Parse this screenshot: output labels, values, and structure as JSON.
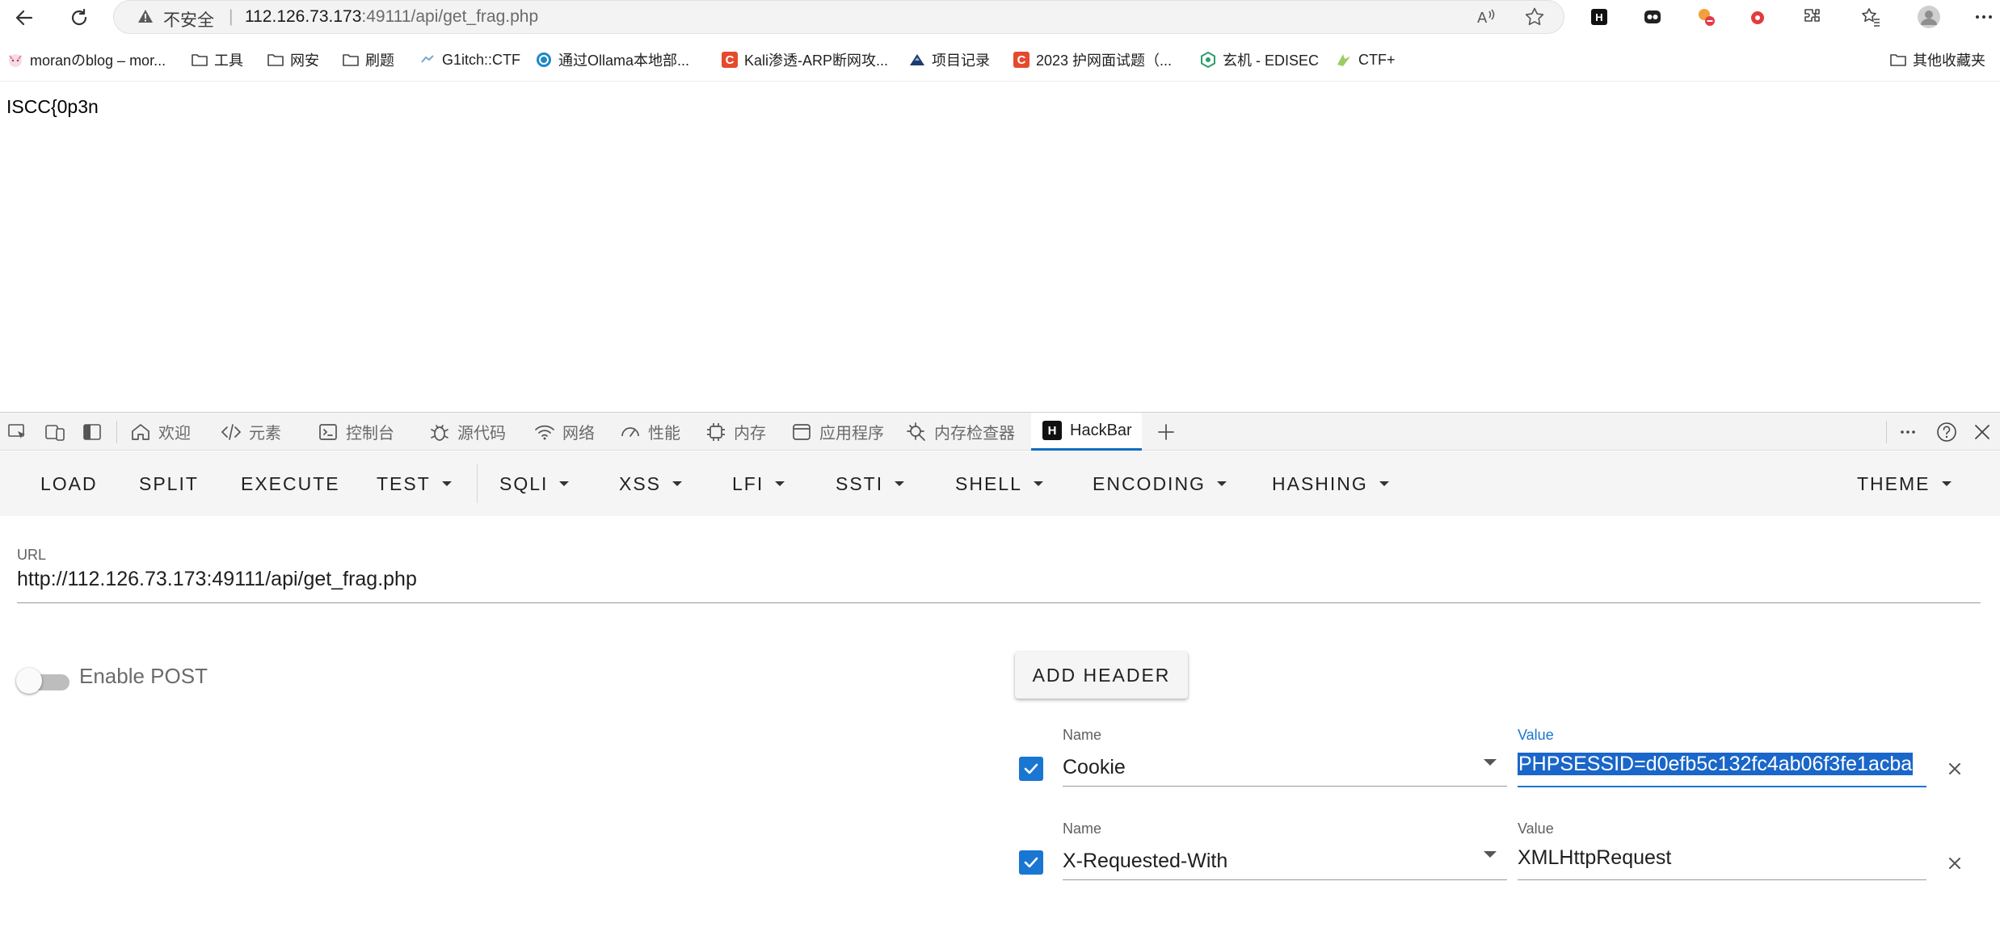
{
  "browser": {
    "insecure_label": "不安全",
    "address_host": "112.126.73.173",
    "address_path": ":49111/api/get_frag.php"
  },
  "bookmarks": [
    {
      "label": "moranのblog – mor...",
      "icon": "cat-favicon"
    },
    {
      "label": "工具",
      "icon": "folder-icon"
    },
    {
      "label": "网安",
      "icon": "folder-icon"
    },
    {
      "label": "刷题",
      "icon": "folder-icon"
    },
    {
      "label": "G1itch::CTF",
      "icon": "glitch-favicon"
    },
    {
      "label": "通过Ollama本地部...",
      "icon": "ollama-favicon"
    },
    {
      "label": "Kali渗透-ARP断网攻...",
      "icon": "csdn-favicon"
    },
    {
      "label": "项目记录",
      "icon": "mountain-favicon"
    },
    {
      "label": "2023 护网面试题（...",
      "icon": "csdn-favicon"
    },
    {
      "label": "玄机 - EDISEC",
      "icon": "hex-favicon"
    },
    {
      "label": "CTF+",
      "icon": "ctfplus-favicon"
    },
    {
      "label": "其他收藏夹",
      "icon": "folder-icon"
    }
  ],
  "page": {
    "body_text": "ISCC{0p3n"
  },
  "devtools": {
    "tabs": [
      {
        "label": "欢迎",
        "icon": "home-icon"
      },
      {
        "label": "元素",
        "icon": "code-icon"
      },
      {
        "label": "控制台",
        "icon": "console-icon"
      },
      {
        "label": "源代码",
        "icon": "bug-icon"
      },
      {
        "label": "网络",
        "icon": "wifi-icon"
      },
      {
        "label": "性能",
        "icon": "gauge-icon"
      },
      {
        "label": "内存",
        "icon": "chip-icon"
      },
      {
        "label": "应用程序",
        "icon": "app-icon"
      },
      {
        "label": "内存检查器",
        "icon": "memory-inspector-icon"
      },
      {
        "label": "HackBar",
        "icon": "hackbar-icon"
      }
    ],
    "active_tab": "HackBar"
  },
  "hackbar": {
    "toolbar": {
      "load": "LOAD",
      "split": "SPLIT",
      "execute": "EXECUTE",
      "test": "TEST",
      "sqli": "SQLI",
      "xss": "XSS",
      "lfi": "LFI",
      "ssti": "SSTI",
      "shell": "SHELL",
      "encoding": "ENCODING",
      "hashing": "HASHING",
      "theme": "THEME"
    },
    "url_label": "URL",
    "url_value": "http://112.126.73.173:49111/api/get_frag.php",
    "enable_post_label": "Enable POST",
    "enable_post": false,
    "add_header_label": "ADD HEADER",
    "headers": [
      {
        "checked": true,
        "name_label": "Name",
        "name": "Cookie",
        "value_label": "Value",
        "value": "PHPSESSID=d0efb5c132fc4ab06f3fe1acba"
      },
      {
        "checked": true,
        "name_label": "Name",
        "name": "X-Requested-With",
        "value_label": "Value",
        "value": "XMLHttpRequest"
      }
    ]
  },
  "colors": {
    "accent": "#1976d2",
    "selection": "#1a66c9",
    "active_tab_underline": "#0f6cbd"
  }
}
